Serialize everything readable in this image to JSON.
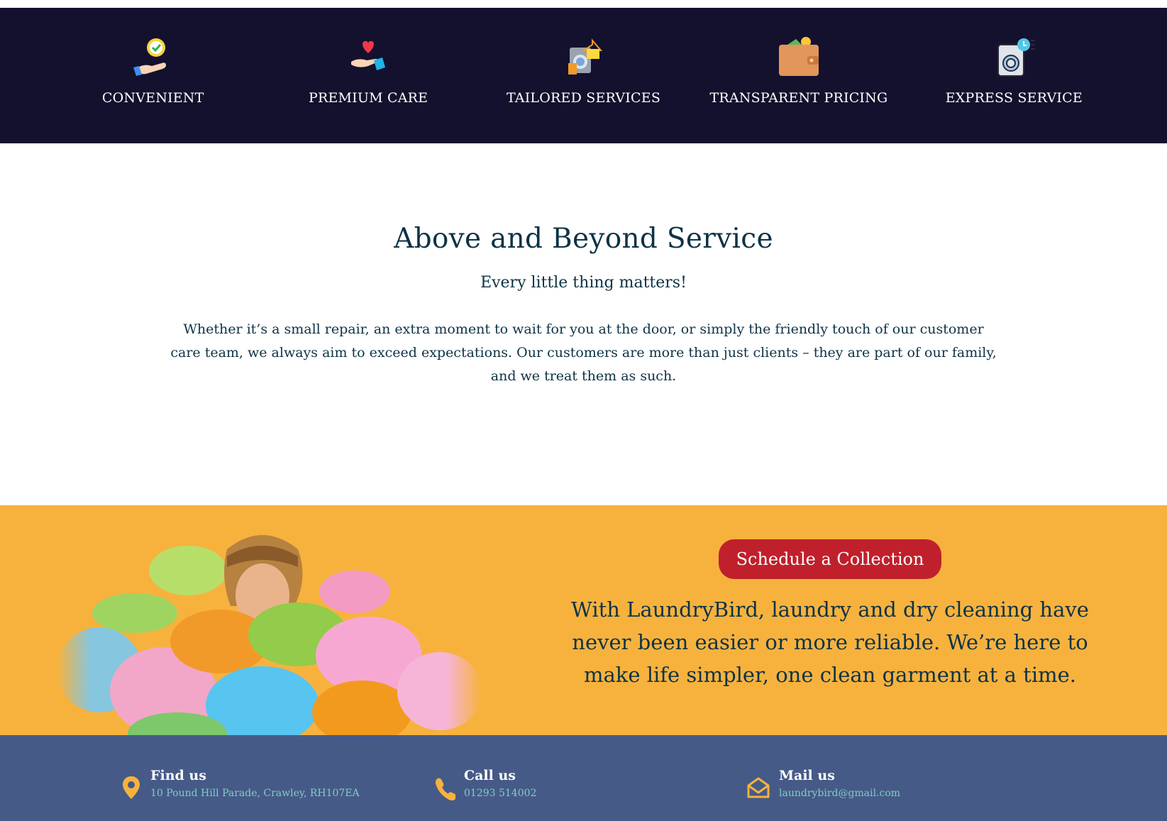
{
  "features": [
    {
      "label": "CONVENIENT",
      "icon": "hand-clock-icon"
    },
    {
      "label": "PREMIUM CARE",
      "icon": "hand-heart-icon"
    },
    {
      "label": "TAILORED SERVICES",
      "icon": "washer-hanger-icon"
    },
    {
      "label": "TRANSPARENT PRICING",
      "icon": "wallet-icon"
    },
    {
      "label": "EXPRESS SERVICE",
      "icon": "washer-timer-icon"
    }
  ],
  "about": {
    "title": "Above and Beyond Service",
    "subtitle": "Every little thing matters!",
    "body": "Whether it’s a small repair, an extra moment to wait for you at the door, or simply the friendly touch of our customer care team, we always aim to exceed expectations. Our customers are more than just clients – they are part of our family, and we treat them as such."
  },
  "cta": {
    "button_label": "Schedule a Collection",
    "text": "With LaundryBird, laundry and dry cleaning have never been easier or more reliable. We’re here to make life simpler, one clean garment at a time."
  },
  "footer": {
    "find": {
      "title": "Find us",
      "value": "10 Pound Hill Parade, Crawley, RH107EA",
      "icon": "location-pin-icon"
    },
    "call": {
      "title": "Call us",
      "value": "01293 514002",
      "icon": "phone-icon"
    },
    "mail": {
      "title": "Mail us",
      "value": "laundrybird@gmail.com",
      "icon": "envelope-icon"
    }
  },
  "colors": {
    "dark_band": "#14112e",
    "cta_band": "#f7b23e",
    "button": "#c0202c",
    "footer": "#465a87",
    "accent_icon": "#f7b23e"
  }
}
